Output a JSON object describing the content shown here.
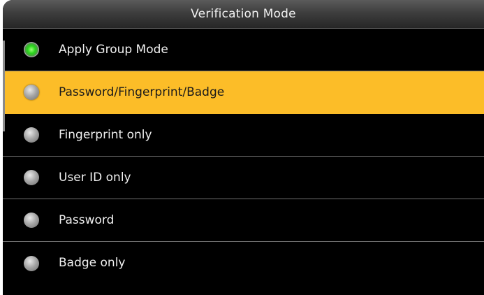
{
  "title": "Verification Mode",
  "options": [
    {
      "label": "Apply Group Mode",
      "checked": true,
      "highlighted": false
    },
    {
      "label": "Password/Fingerprint/Badge",
      "checked": false,
      "highlighted": true
    },
    {
      "label": "Fingerprint only",
      "checked": false,
      "highlighted": false
    },
    {
      "label": "User ID only",
      "checked": false,
      "highlighted": false
    },
    {
      "label": "Password",
      "checked": false,
      "highlighted": false
    },
    {
      "label": "Badge only",
      "checked": false,
      "highlighted": false
    }
  ],
  "colors": {
    "highlight": "#fcbd28",
    "background": "#000000",
    "radio_checked": "#27d61a",
    "radio_unchecked": "#a8a8a8"
  }
}
